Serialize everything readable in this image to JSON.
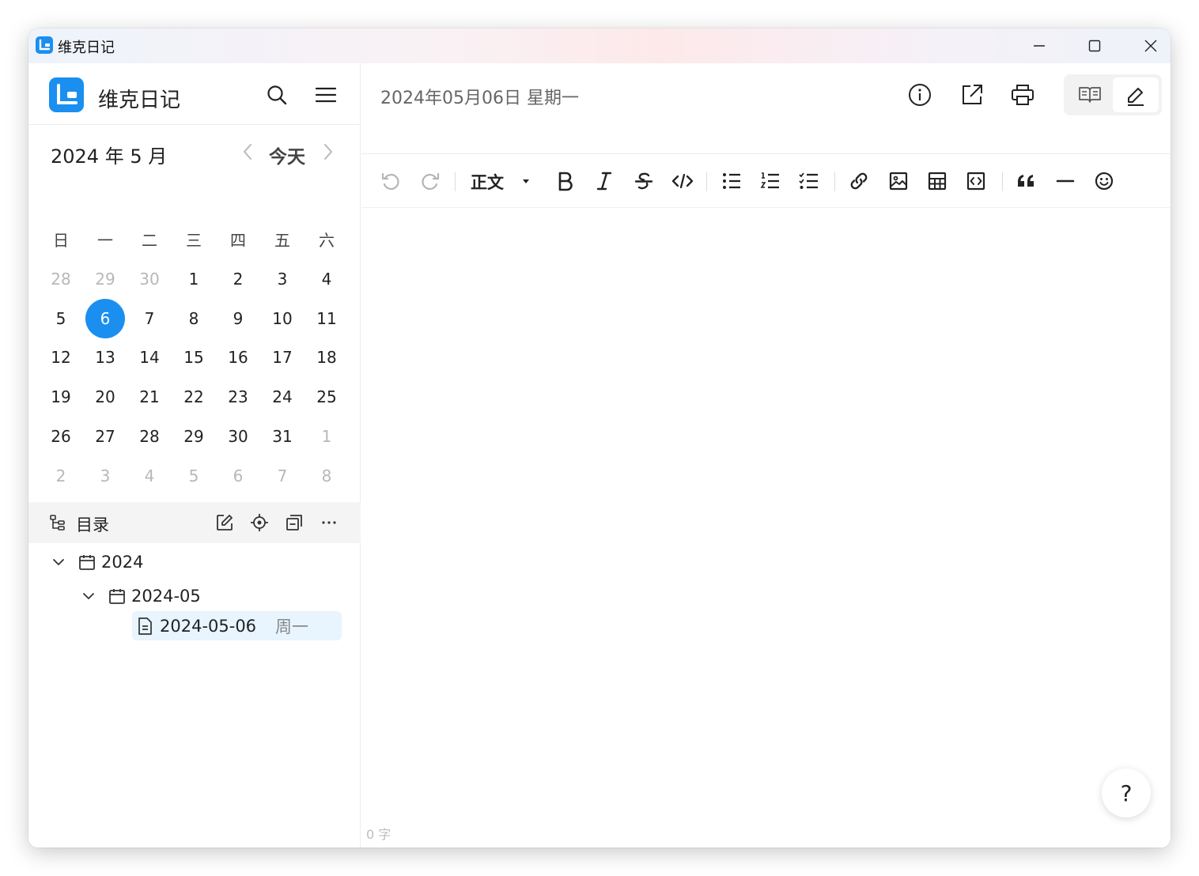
{
  "window": {
    "title": "维克日记"
  },
  "sidebar": {
    "app_name": "维克日记",
    "calendar": {
      "month_label": "2024 年 5 月",
      "today_label": "今天",
      "weekdays": [
        "日",
        "一",
        "二",
        "三",
        "四",
        "五",
        "六"
      ],
      "days": [
        {
          "d": "28",
          "muted": true
        },
        {
          "d": "29",
          "muted": true
        },
        {
          "d": "30",
          "muted": true
        },
        {
          "d": "1"
        },
        {
          "d": "2"
        },
        {
          "d": "3"
        },
        {
          "d": "4"
        },
        {
          "d": "5"
        },
        {
          "d": "6",
          "selected": true
        },
        {
          "d": "7"
        },
        {
          "d": "8"
        },
        {
          "d": "9"
        },
        {
          "d": "10"
        },
        {
          "d": "11"
        },
        {
          "d": "12"
        },
        {
          "d": "13"
        },
        {
          "d": "14"
        },
        {
          "d": "15"
        },
        {
          "d": "16"
        },
        {
          "d": "17"
        },
        {
          "d": "18"
        },
        {
          "d": "19"
        },
        {
          "d": "20"
        },
        {
          "d": "21"
        },
        {
          "d": "22"
        },
        {
          "d": "23"
        },
        {
          "d": "24"
        },
        {
          "d": "25"
        },
        {
          "d": "26"
        },
        {
          "d": "27"
        },
        {
          "d": "28"
        },
        {
          "d": "29"
        },
        {
          "d": "30"
        },
        {
          "d": "31"
        },
        {
          "d": "1",
          "muted": true
        },
        {
          "d": "2",
          "muted": true
        },
        {
          "d": "3",
          "muted": true
        },
        {
          "d": "4",
          "muted": true
        },
        {
          "d": "5",
          "muted": true
        },
        {
          "d": "6",
          "muted": true
        },
        {
          "d": "7",
          "muted": true
        },
        {
          "d": "8",
          "muted": true
        }
      ]
    },
    "toc": {
      "title": "目录",
      "year": "2024",
      "month": "2024-05",
      "entry_date": "2024-05-06",
      "entry_weekday": "周一"
    }
  },
  "main": {
    "doc_date": "2024年05月06日 星期一",
    "paragraph_style": "正文",
    "word_count": "0 字",
    "help_label": "?"
  },
  "colors": {
    "accent": "#1a8ff0",
    "selected_row": "#e8f4fe"
  }
}
